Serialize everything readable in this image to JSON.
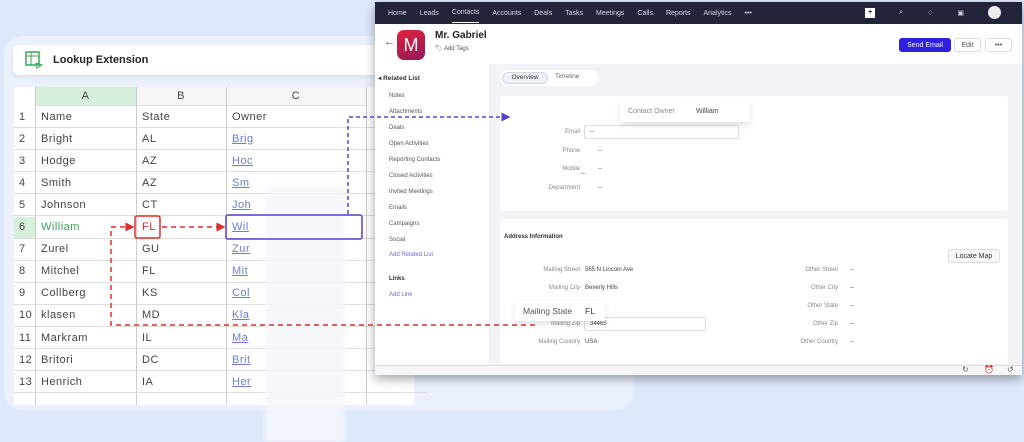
{
  "sheet": {
    "title": "Lookup Extension",
    "columns": [
      "A",
      "B",
      "C"
    ],
    "rows": [
      {
        "n": "1",
        "name": "Name",
        "state": "State",
        "owner": "Owner"
      },
      {
        "n": "2",
        "name": "Bright",
        "state": "AL",
        "owner": "Brig"
      },
      {
        "n": "3",
        "name": "Hodge",
        "state": "AZ",
        "owner": "Hoc"
      },
      {
        "n": "4",
        "name": "Smith",
        "state": "AZ",
        "owner": "Sm"
      },
      {
        "n": "5",
        "name": "Johnson",
        "state": "CT",
        "owner": "Joh"
      },
      {
        "n": "6",
        "name": "William",
        "state": "FL",
        "owner": "Wil"
      },
      {
        "n": "7",
        "name": "Zurel",
        "state": "GU",
        "owner": "Zur"
      },
      {
        "n": "8",
        "name": "Mitchel",
        "state": "FL",
        "owner": "Mit"
      },
      {
        "n": "9",
        "name": "Collberg",
        "state": "KS",
        "owner": "Col"
      },
      {
        "n": "10",
        "name": "klasen",
        "state": "MD",
        "owner": "Kla"
      },
      {
        "n": "11",
        "name": "Markram",
        "state": "IL",
        "owner": "Ma"
      },
      {
        "n": "12",
        "name": "Britori",
        "state": "DC",
        "owner": "Brit"
      },
      {
        "n": "13",
        "name": "Henrich",
        "state": "IA",
        "owner": "Her"
      }
    ],
    "selected_row": "6"
  },
  "crm": {
    "nav": [
      "Home",
      "Leads",
      "Contacts",
      "Accounts",
      "Deals",
      "Tasks",
      "Meetings",
      "Calls",
      "Reports",
      "Analytics",
      "•••"
    ],
    "active_nav": "Contacts",
    "contact": {
      "initial": "M",
      "name": "Mr. Gabriel",
      "add_tags": "Add Tags"
    },
    "buttons": {
      "send_email": "Send Email",
      "edit": "Edit",
      "more": "•••",
      "locate_map": "Locate Map"
    },
    "related_list": {
      "title": "Related List",
      "items": [
        "Notes",
        "Attachments",
        "Deals",
        "Open Activities",
        "Reporting Contacts",
        "Closed Activities",
        "Invited Meetings",
        "Emails",
        "Campaigns",
        "Social"
      ],
      "add": "Add Related List"
    },
    "links": {
      "title": "Links",
      "add": "Add Link"
    },
    "tabs": [
      "Overview",
      "Timeline"
    ],
    "overview": {
      "owner_label": "Contact Owner",
      "owner_value": "William",
      "fields": [
        {
          "label": "Email",
          "value": "--"
        },
        {
          "label": "Phone",
          "value": "--"
        },
        {
          "label": "Mobile",
          "value": "--"
        },
        {
          "label": "Department",
          "value": "--"
        }
      ]
    },
    "address": {
      "title": "Address Information",
      "left": [
        {
          "label": "Mailing Street",
          "value": "565 N Lincoin Ave"
        },
        {
          "label": "Mailing City",
          "value": "Beverly Hills"
        },
        {
          "label": "Mailing State",
          "value": "FL"
        },
        {
          "label": "Mailing Zip",
          "value": "34465"
        },
        {
          "label": "Mailing Country",
          "value": "USA"
        }
      ],
      "right": [
        {
          "label": "Other Street",
          "value": "--"
        },
        {
          "label": "Other City",
          "value": "--"
        },
        {
          "label": "Other State",
          "value": "--"
        },
        {
          "label": "Other Zip",
          "value": "--"
        },
        {
          "label": "Other Country",
          "value": "--"
        }
      ]
    }
  },
  "colors": {
    "nav_bg": "#22243a",
    "send_email": "#2f1fe0",
    "green": "#3aa655",
    "red": "#e02b2b",
    "purple": "#5b3fd1"
  }
}
